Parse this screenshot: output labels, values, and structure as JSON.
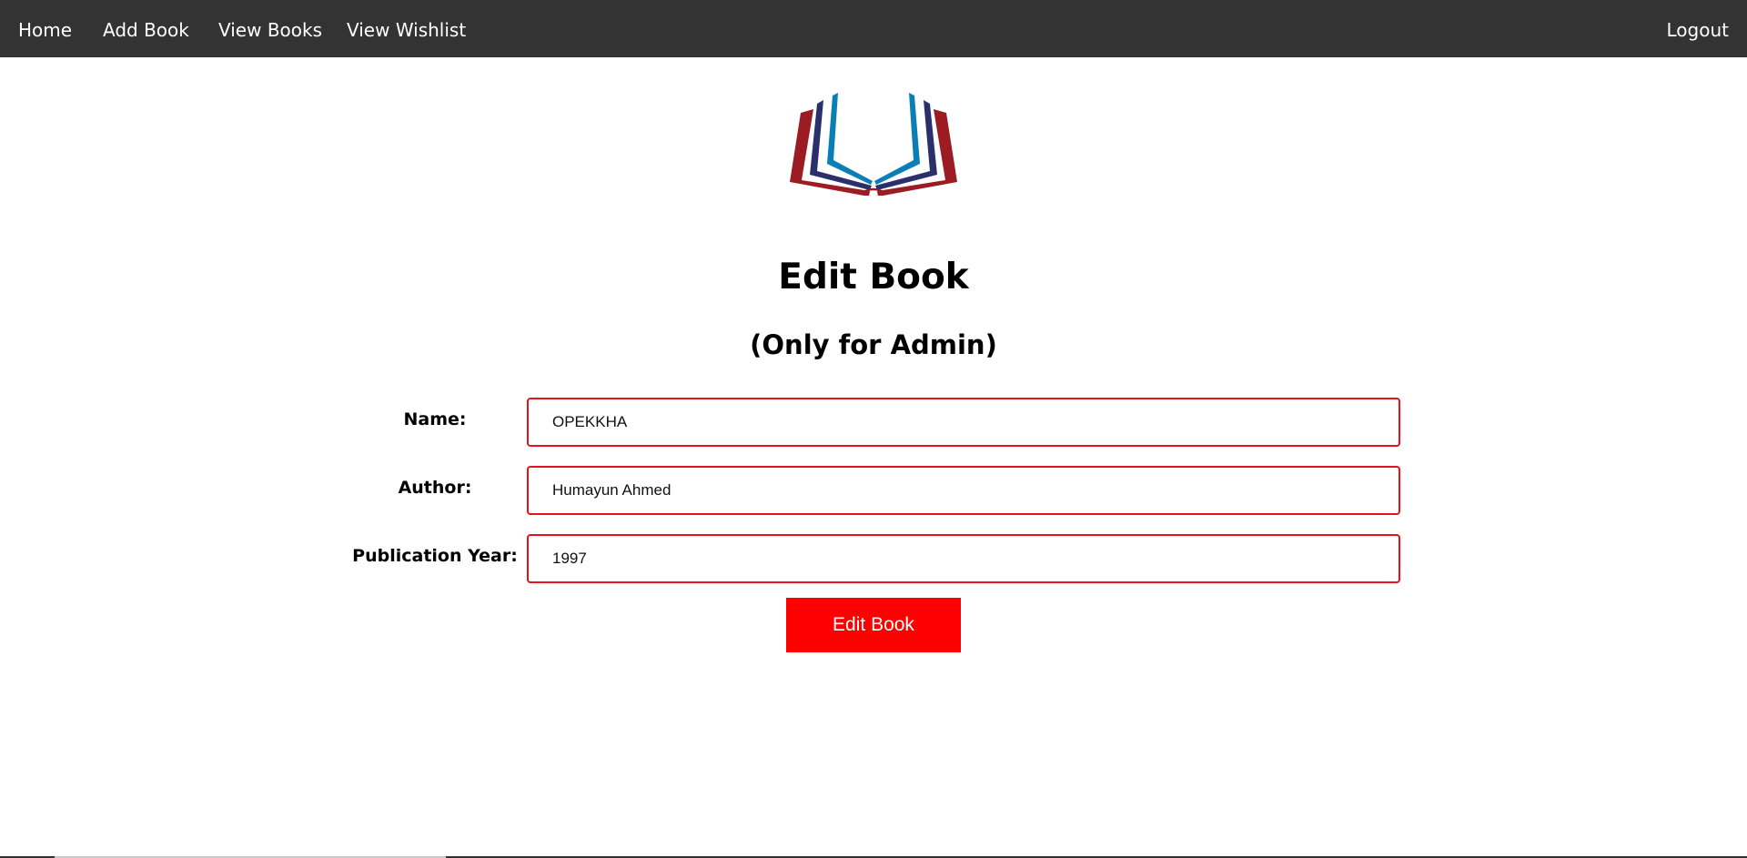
{
  "nav": {
    "home": "Home",
    "add_book": "Add Book",
    "view_books": "View Books",
    "view_wishlist": "View Wishlist",
    "logout": "Logout"
  },
  "logo": {
    "icon": "open-book-logo",
    "colors": [
      "#9b1c22",
      "#2b2f6b",
      "#0a7fb5"
    ]
  },
  "page": {
    "title": "Edit Book",
    "subtitle": "(Only for Admin)"
  },
  "form": {
    "name_label": "Name:",
    "name_value": "OPEKKHA",
    "author_label": "Author:",
    "author_value": "Humayun Ahmed",
    "year_label": "Publication Year:",
    "year_value": "1997",
    "submit_label": "Edit Book"
  },
  "colors": {
    "navbar": "#333333",
    "accent": "#ff0000",
    "input_border": "#e8121c"
  }
}
